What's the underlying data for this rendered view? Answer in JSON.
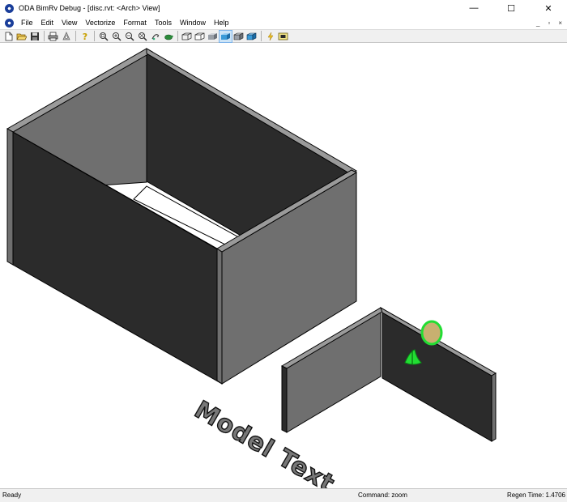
{
  "window": {
    "title": "ODA BimRv Debug - [disc.rvt: <Arch> View]",
    "controls": [
      "—",
      "☐",
      "✕"
    ]
  },
  "menubar": {
    "items": [
      "File",
      "Edit",
      "View",
      "Vectorize",
      "Format",
      "Tools",
      "Window",
      "Help"
    ],
    "mdi_controls": [
      "_",
      "▫",
      "×"
    ]
  },
  "toolbar": {
    "buttons": [
      {
        "name": "new-file",
        "icon": "new-document-icon"
      },
      {
        "name": "open-file",
        "icon": "folder-open-icon"
      },
      {
        "name": "save-file",
        "icon": "floppy-disk-icon"
      },
      {
        "name": "print",
        "icon": "printer-icon"
      },
      {
        "name": "print-preview",
        "icon": "preview-icon"
      },
      {
        "name": "help",
        "icon": "help-icon"
      },
      {
        "name": "zoom-window",
        "icon": "zoom-window-icon"
      },
      {
        "name": "zoom-in",
        "icon": "zoom-in-icon"
      },
      {
        "name": "zoom-out",
        "icon": "zoom-out-icon"
      },
      {
        "name": "zoom-extents",
        "icon": "zoom-extents-icon"
      },
      {
        "name": "orbit",
        "icon": "orbit-icon"
      },
      {
        "name": "render-mode",
        "icon": "turtle-icon"
      },
      {
        "name": "wireframe",
        "icon": "wireframe-box-icon"
      },
      {
        "name": "hidden-line",
        "icon": "hidden-line-box-icon"
      },
      {
        "name": "flat-shaded",
        "icon": "flat-shaded-box-icon"
      },
      {
        "name": "gouraud-shaded",
        "icon": "gouraud-shaded-box-icon"
      },
      {
        "name": "flat-with-edges",
        "icon": "flat-edges-box-icon"
      },
      {
        "name": "gouraud-with-edges",
        "icon": "gouraud-edges-box-icon"
      },
      {
        "name": "lightning",
        "icon": "lightning-icon"
      },
      {
        "name": "background",
        "icon": "image-frame-icon"
      }
    ],
    "active_button": "gouraud-shaded"
  },
  "viewport": {
    "model_text": "Model Text",
    "colors": {
      "wall_dark": "#2b2b2b",
      "wall_mid": "#6f6f6f",
      "wall_top": "#9a9a9a",
      "edge": "#000000",
      "highlight_green": "#22dd33",
      "highlight_tan": "#c8b070"
    }
  },
  "statusbar": {
    "ready": "Ready",
    "command": "Command: zoom",
    "regen": "Regen Time: 1.4706"
  }
}
